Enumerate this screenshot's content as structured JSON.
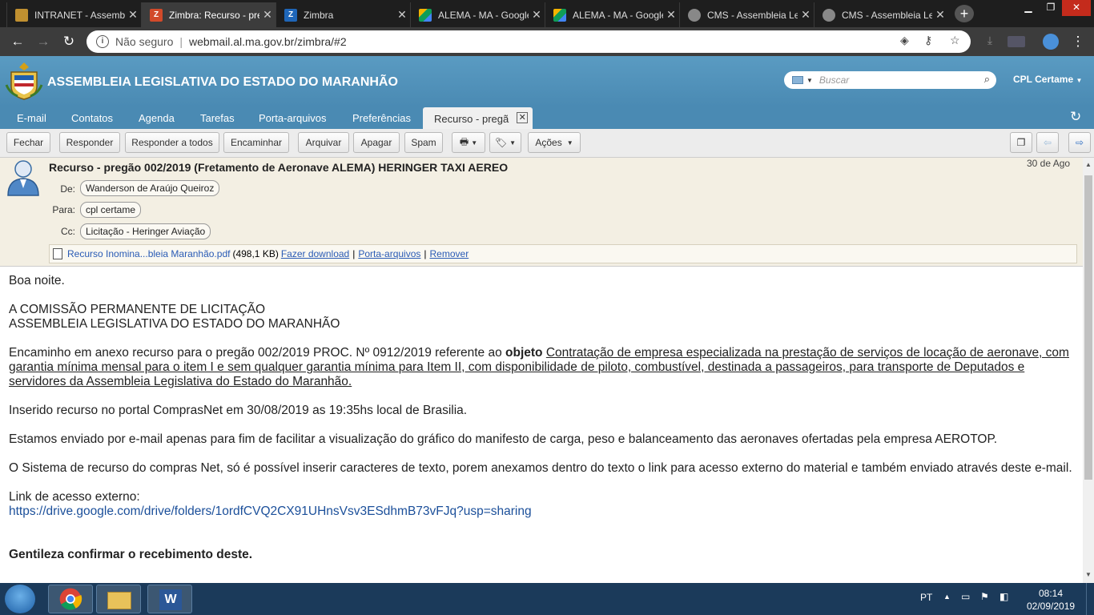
{
  "browser": {
    "tabs": [
      {
        "title": "INTRANET - Assembleia",
        "icon": "intranet-favicon",
        "color": "#c09030"
      },
      {
        "title": "Zimbra: Recurso - pregão",
        "icon": "zimbra-favicon",
        "color": "#d24a2a"
      },
      {
        "title": "Zimbra",
        "icon": "zimbra-z-favicon",
        "color": "#1f66b8"
      },
      {
        "title": "ALEMA - MA - Google Drive",
        "icon": "google-drive-favicon",
        "color": "#f4b400"
      },
      {
        "title": "ALEMA - MA - Google Drive",
        "icon": "google-drive-favicon",
        "color": "#f4b400"
      },
      {
        "title": "CMS - Assembleia Legislativa",
        "icon": "globe-favicon",
        "color": "#888888"
      },
      {
        "title": "CMS - Assembleia Legislativa",
        "icon": "globe-favicon",
        "color": "#888888"
      }
    ],
    "new_tab": "+",
    "security": "Não seguro",
    "url": "webmail.al.ma.gov.br/zimbra/#2"
  },
  "app": {
    "title": "ASSEMBLEIA LEGISLATIVA DO ESTADO DO MARANHÃO",
    "search_placeholder": "Buscar",
    "user": "CPL Certame",
    "nav": [
      "E-mail",
      "Contatos",
      "Agenda",
      "Tarefas",
      "Porta-arquivos",
      "Preferências"
    ],
    "active_tab": "Recurso - pregã",
    "accent": "#4a8ab3"
  },
  "toolbar": {
    "close": "Fechar",
    "reply": "Responder",
    "reply_all": "Responder a todos",
    "forward": "Encaminhar",
    "archive": "Arquivar",
    "delete": "Apagar",
    "spam": "Spam",
    "actions": "Ações"
  },
  "message": {
    "subject": "Recurso - pregão 002/2019 (Fretamento de Aeronave ALEMA) HERINGER TAXI AEREO",
    "date": "30 de Ago",
    "from_label": "De:",
    "from": "Wanderson de Araújo Queiroz",
    "to_label": "Para:",
    "to": "cpl certame",
    "cc_label": "Cc:",
    "cc": "Licitação - Heringer Aviação",
    "attachment": {
      "name": "Recurso Inomina...bleia Maranhão.pdf",
      "size": "(498,1 KB)",
      "download": "Fazer download",
      "briefcase": "Porta-arquivos",
      "remove": "Remover",
      "sep": "|"
    },
    "body": {
      "greeting": "Boa noite.",
      "addressee1": "A COMISSÃO PERMANENTE DE LICITAÇÃO",
      "addressee2": "ASSEMBLEIA LEGISLATIVA DO ESTADO DO MARANHÃO",
      "p1_start": "Encaminho em anexo recurso para o pregão 002/2019 PROC. Nº 0912/2019 referente ao ",
      "p1_bold": "objeto",
      "p1_underlined": "Contratação de empresa especializada na prestação de serviços de locação de aeronave, com garantia mínima mensal para o item I e sem qualquer garantia mínima para Item II, com disponibilidade de piloto, combustível, destinada a passageiros, para transporte de Deputados e servidores da Assembleia Legislativa do Estado do Maranhão.",
      "p2": "Inserido recurso no portal ComprasNet em 30/08/2019 as 19:35hs local de Brasilia.",
      "p3": "Estamos enviado por e-mail apenas para fim de facilitar a visualização do gráfico do manifesto de carga, peso e balanceamento das aeronaves ofertadas pela empresa AEROTOP.",
      "p4": "O Sistema de recurso do compras Net, só é possível inserir caracteres de texto, porem anexamos dentro do texto o link para acesso externo do material e também enviado através deste e-mail.",
      "link_label": "Link de acesso externo:",
      "link": "https://drive.google.com/drive/folders/1ordfCVQ2CX91UHnsVsv3ESdhmB73vFJq?usp=sharing",
      "closing": "Gentileza confirmar o recebimento deste."
    }
  },
  "taskbar": {
    "lang": "PT",
    "time": "08:14",
    "date": "02/09/2019"
  }
}
